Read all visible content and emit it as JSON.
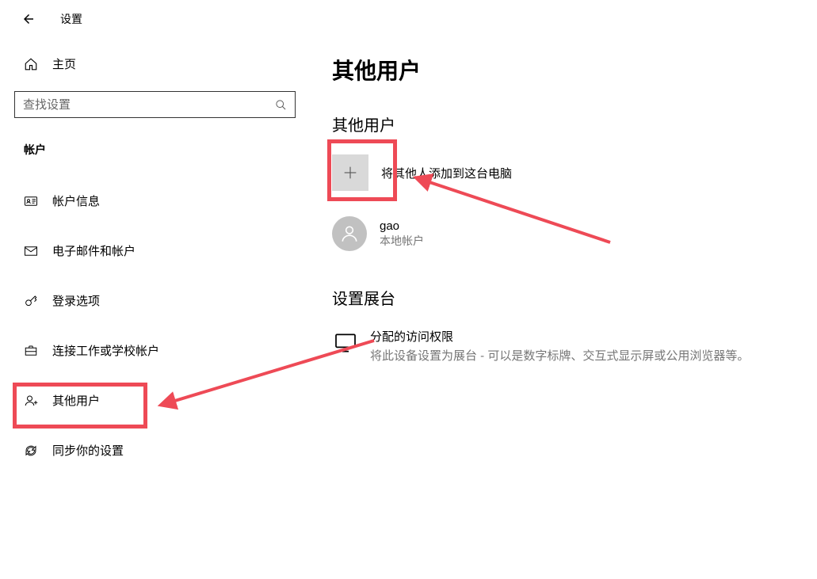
{
  "header": {
    "window_title": "设置"
  },
  "sidebar": {
    "home_label": "主页",
    "search_placeholder": "查找设置",
    "section_label": "帐户",
    "items": [
      {
        "icon": "id-card-icon",
        "label": "帐户信息"
      },
      {
        "icon": "envelope-icon",
        "label": "电子邮件和帐户"
      },
      {
        "icon": "key-icon",
        "label": "登录选项"
      },
      {
        "icon": "briefcase-icon",
        "label": "连接工作或学校帐户"
      },
      {
        "icon": "person-add-icon",
        "label": "其他用户"
      },
      {
        "icon": "sync-icon",
        "label": "同步你的设置"
      }
    ]
  },
  "main": {
    "title": "其他用户",
    "section_other_users": "其他用户",
    "add_user_label": "将其他人添加到这台电脑",
    "user": {
      "name": "gao",
      "type": "本地帐户"
    },
    "section_kiosk": "设置展台",
    "kiosk": {
      "title": "分配的访问权限",
      "desc": "将此设备设置为展台 - 可以是数字标牌、交互式显示屏或公用浏览器等。"
    }
  },
  "annotations": {
    "highlight_color": "#ee4a56"
  }
}
